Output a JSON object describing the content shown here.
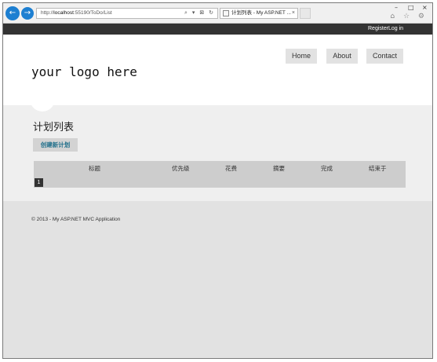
{
  "browser": {
    "url_prefix": "http://",
    "url_host": "localhost",
    "url_rest": ":55190/ToDo/List",
    "addr_icons": "⌕ ▾ ⊠ ↻",
    "tab_title": "计划列表 - My ASP.NET ...",
    "tab_close": "×",
    "win_min": "–",
    "win_max": "□",
    "win_close": "×",
    "tool_icons": "⌂ ☆ ⚙",
    "back_icon": "←",
    "forward_icon": "→"
  },
  "topbar": {
    "register_label": "Register",
    "login_label": "Log in"
  },
  "header": {
    "logo_text": "your logo here",
    "menu": [
      "Home",
      "About",
      "Contact"
    ]
  },
  "main": {
    "title": "计划列表",
    "create_label": "创建新计划",
    "columns": [
      "标题",
      "优先级",
      "花费",
      "摘要",
      "完成",
      "结束于"
    ],
    "page_number": "1"
  },
  "footer": {
    "copyright": "© 2013 - My ASP.NET MVC Application"
  }
}
